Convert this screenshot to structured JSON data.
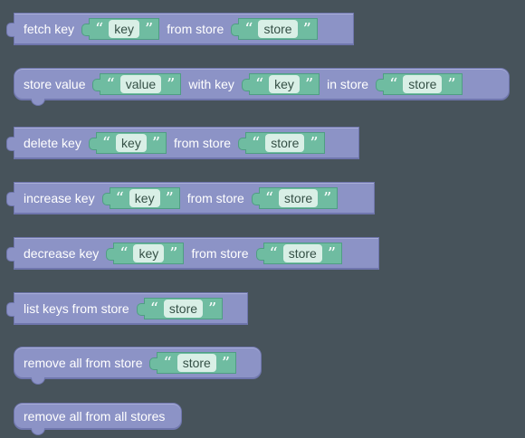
{
  "blocks": [
    {
      "text": [
        "fetch key",
        "from store"
      ],
      "strings": [
        "key",
        "store"
      ]
    },
    {
      "text": [
        "store value",
        "with key",
        "in store"
      ],
      "strings": [
        "value",
        "key",
        "store"
      ]
    },
    {
      "text": [
        "delete key",
        "from store"
      ],
      "strings": [
        "key",
        "store"
      ]
    },
    {
      "text": [
        "increase key",
        "from store"
      ],
      "strings": [
        "key",
        "store"
      ]
    },
    {
      "text": [
        "decrease key",
        "from store"
      ],
      "strings": [
        "key",
        "store"
      ]
    },
    {
      "text": [
        "list keys from store"
      ],
      "strings": [
        "store"
      ]
    },
    {
      "text": [
        "remove all from store"
      ],
      "strings": [
        "store"
      ]
    },
    {
      "text": [
        "remove all from all stores"
      ],
      "strings": []
    }
  ],
  "quote_open": "“",
  "quote_close": "”",
  "colors": {
    "workspace_bg": "#47535b",
    "block_purple": "#8c93c6",
    "string_green": "#6fbca1",
    "field_bg": "#d9efe6"
  }
}
